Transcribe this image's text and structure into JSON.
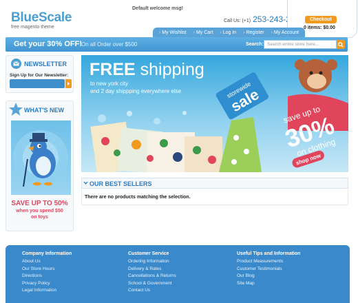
{
  "header": {
    "brand": "BlueScale",
    "tagline": "free magento theme",
    "welcome": "Default welcome msg!",
    "call_label": "Call Us: (+1)",
    "call_number": "253-243-2001",
    "checkout": "Checkout",
    "cart_status": "0 items: $0.00",
    "top_links": [
      "My Wishlist",
      "My Cart",
      "Log In",
      "Register",
      "My Account"
    ]
  },
  "promo": {
    "headline": "Get your 30% OFF!",
    "subline": "On all Order over $500",
    "search_label": "Search:",
    "search_placeholder": "Search entire store here..."
  },
  "sidebar": {
    "newsletter_title": "NEWSLETTER",
    "newsletter_label": "Sign Up for Our Newsletter:",
    "whats_new_title": "WHAT'S NEW",
    "whats_new_promo": "SAVE UP TO 50%",
    "whats_new_line1": "when you spend $50",
    "whats_new_line2": "on toys"
  },
  "banner": {
    "headline_bold": "FREE",
    "headline_light": " shipping",
    "line1": "to new york city",
    "line2": "and 2 day shippping everywhere else",
    "badge_line1": "storewide",
    "badge_line2": "sale",
    "save_line1": "save up to",
    "save_percent": "30%",
    "save_line2": "on clothing",
    "shop_now": "shop now"
  },
  "main": {
    "best_sellers_title": "OUR BEST SELLERS",
    "no_products": "There are no products matching the selection."
  },
  "footer": {
    "columns": [
      {
        "title": "Company Information",
        "links": [
          "About Us",
          "Our Store Hours",
          "Directions",
          "Privacy Policy",
          "Legal Information"
        ]
      },
      {
        "title": "Customer Service",
        "links": [
          "Ordering Information",
          "Delivery & Rates",
          "Cancellations & Returns",
          "School & Government",
          "Contact Us"
        ]
      },
      {
        "title": "Useful Tips and Information",
        "links": [
          "Product Measurements",
          "Customer Testimonials",
          "Our Blog",
          "Site Map"
        ]
      }
    ]
  },
  "colors": {
    "brand_blue": "#4a9fd5",
    "accent_orange": "#f29a1d",
    "sale_pink": "#e0455c",
    "footer_blue": "#3a8acb"
  },
  "icons": [
    "search-icon",
    "envelope-icon",
    "star-icon",
    "chevron-down-icon"
  ]
}
